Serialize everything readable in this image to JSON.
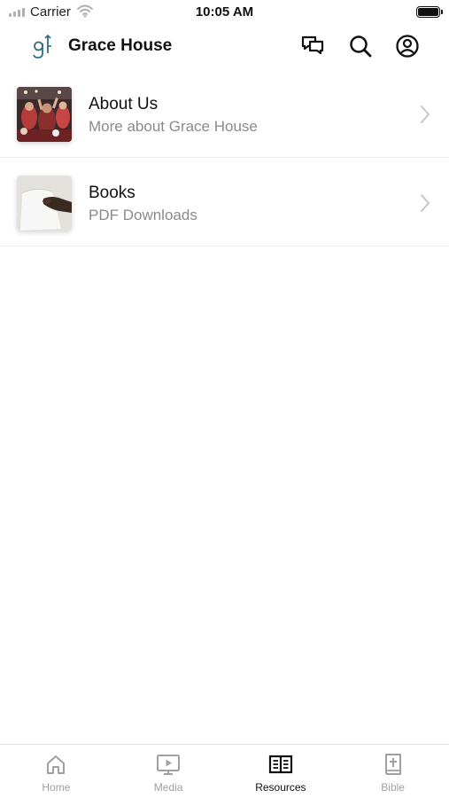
{
  "status_bar": {
    "carrier": "Carrier",
    "time": "10:05 AM"
  },
  "header": {
    "title": "Grace House",
    "logo_icon": "grace-house-logo",
    "actions": [
      "chat-bubbles-icon",
      "search-icon",
      "user-profile-icon"
    ]
  },
  "resources": [
    {
      "title": "About Us",
      "subtitle": "More about Grace House",
      "thumbnail": "worship-crowd-photo"
    },
    {
      "title": "Books",
      "subtitle": "PDF Downloads",
      "thumbnail": "hand-holding-paper-photo"
    }
  ],
  "tab_bar": {
    "active": "Resources",
    "tabs": [
      {
        "label": "Home",
        "icon": "home-icon"
      },
      {
        "label": "Media",
        "icon": "play-screen-icon"
      },
      {
        "label": "Resources",
        "icon": "open-book-icon"
      },
      {
        "label": "Bible",
        "icon": "bible-cross-icon"
      }
    ]
  },
  "colors": {
    "accent_logo": "#2f6f86",
    "active_tab": "#111111",
    "inactive_tab": "#a0a0a0",
    "subtitle_text": "#8a8a8a"
  }
}
